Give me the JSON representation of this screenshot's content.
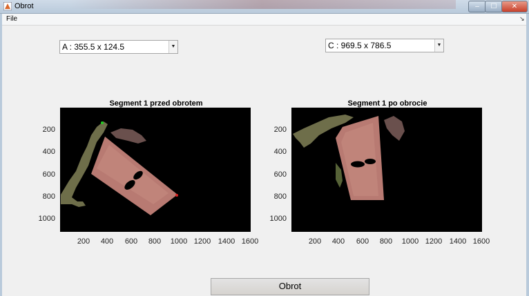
{
  "window": {
    "title": "Obrot",
    "min_glyph": "–",
    "max_glyph": "☐",
    "close_glyph": "✕",
    "app_icon": "matlab-figure-icon"
  },
  "menubar": {
    "items": [
      "File"
    ],
    "dock_arrow": "↘"
  },
  "popups": {
    "left": {
      "selected": "A : 355.5 x 124.5",
      "arrow": "▼"
    },
    "right": {
      "selected": "C : 969.5 x 786.5",
      "arrow": "▼"
    }
  },
  "plots": [
    {
      "title": "Segment 1 przed obrotem",
      "x_ticks": [
        "200",
        "400",
        "600",
        "800",
        "1000",
        "1200",
        "1400",
        "1600"
      ],
      "y_ticks": [
        "200",
        "400",
        "600",
        "800",
        "1000"
      ]
    },
    {
      "title": "Segment 1 po obrocie",
      "x_ticks": [
        "200",
        "400",
        "600",
        "800",
        "1000",
        "1200",
        "1400",
        "1600"
      ],
      "y_ticks": [
        "200",
        "400",
        "600",
        "800",
        "1000"
      ]
    }
  ],
  "action_button": {
    "label": "Obrot"
  },
  "colors": {
    "image_bg": "#000000",
    "object": "#b87a72",
    "vegetation": "#7a7a52",
    "marker_start": "#22cc22",
    "marker_end": "#dd2222"
  }
}
